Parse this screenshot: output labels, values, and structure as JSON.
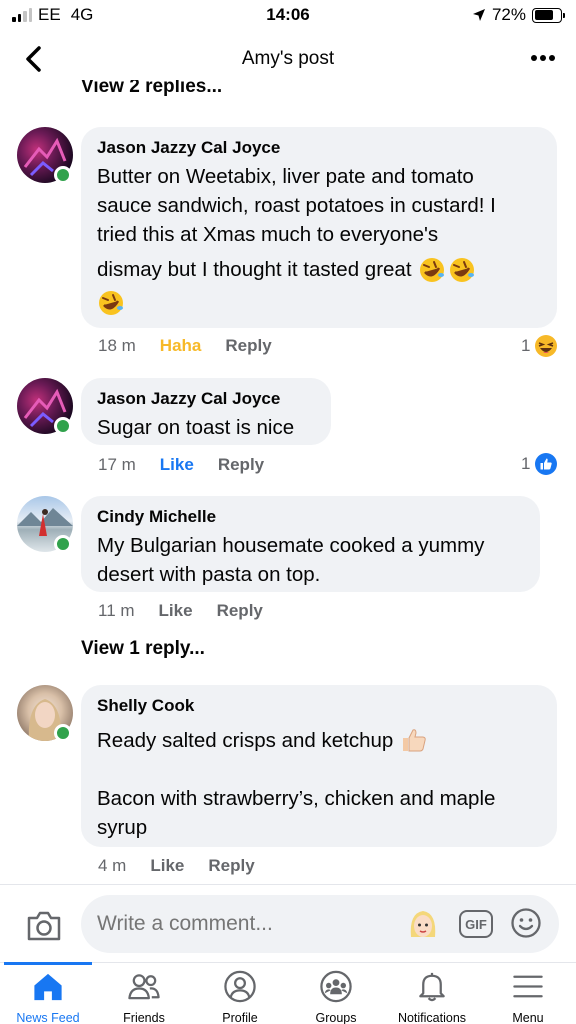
{
  "status_bar": {
    "carrier": "EE",
    "network": "4G",
    "time": "14:06",
    "battery": "72%",
    "battery_level": 0.72
  },
  "header": {
    "title": "Amy's post"
  },
  "view_replies_top": "View 2 replies...",
  "comments": [
    {
      "author": "Jason Jazzy Cal Joyce",
      "lines": [
        "Butter on Weetabix, liver pate and tomato",
        "sauce sandwich, roast potatoes in custard! I",
        "tried this at Xmas much to everyone's",
        "dismay but I thought it tasted great"
      ],
      "time": "18 m",
      "reaction_label": "Haha",
      "reply_label": "Reply",
      "reaction_count": "1"
    },
    {
      "author": "Jason Jazzy Cal Joyce",
      "text": "Sugar on toast is nice",
      "time": "17 m",
      "reaction_label": "Like",
      "reply_label": "Reply",
      "reaction_count": "1"
    },
    {
      "author": "Cindy Michelle",
      "lines": [
        "My Bulgarian housemate cooked a yummy",
        "desert with pasta on top."
      ],
      "time": "11 m",
      "reaction_label": "Like",
      "reply_label": "Reply"
    },
    {
      "author": "Shelly Cook",
      "line1": "Ready salted crisps and ketchup",
      "line2": "Bacon with strawberry’s, chicken and maple",
      "line3": "syrup",
      "time": "4 m",
      "reaction_label": "Like",
      "reply_label": "Reply"
    }
  ],
  "view_replies_mid": "View 1 reply...",
  "composer": {
    "placeholder": "Write a comment...",
    "gif_label": "GIF"
  },
  "tabs": [
    {
      "label": "News Feed",
      "icon": "home-icon",
      "active": true
    },
    {
      "label": "Friends",
      "icon": "friends-icon"
    },
    {
      "label": "Profile",
      "icon": "profile-icon"
    },
    {
      "label": "Groups",
      "icon": "groups-icon"
    },
    {
      "label": "Notifications",
      "icon": "bell-icon"
    },
    {
      "label": "Menu",
      "icon": "menu-icon"
    }
  ],
  "colors": {
    "accent": "#1877f2",
    "haha": "#f7b928",
    "online": "#31a24c",
    "bubble": "#f0f2f5",
    "muted_text": "#65676b"
  }
}
